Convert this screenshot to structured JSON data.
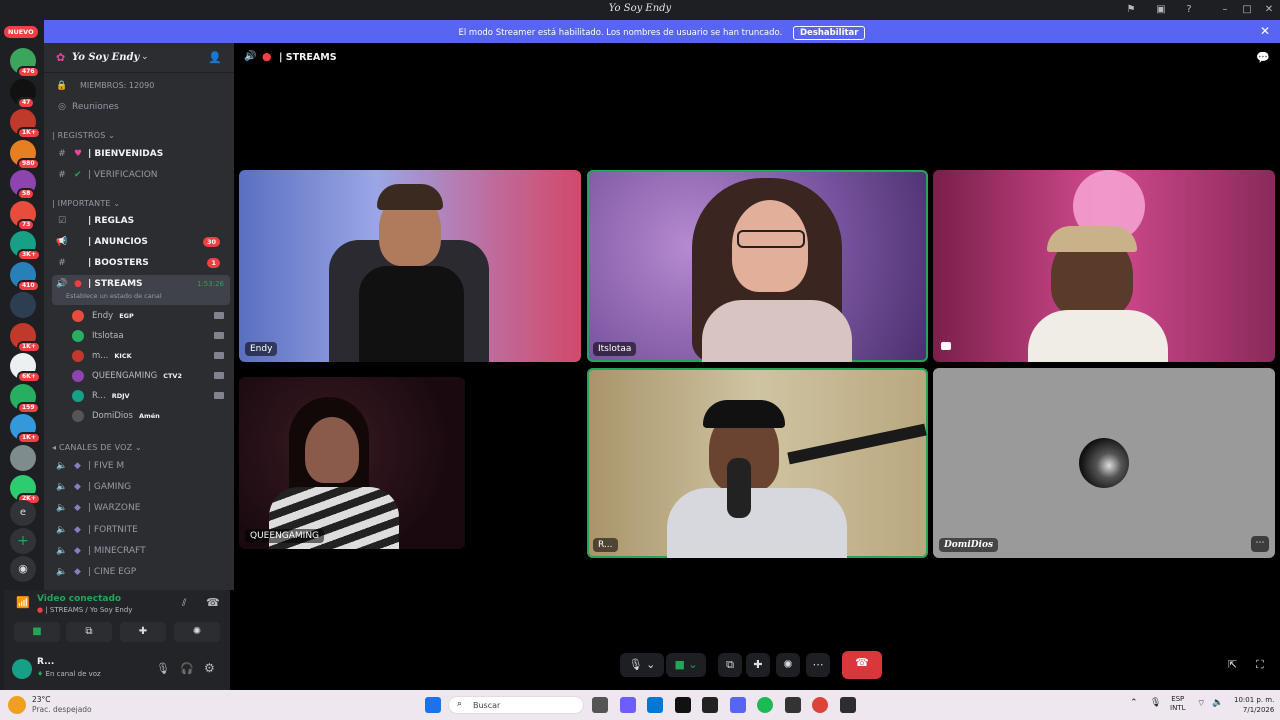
{
  "window": {
    "title": "Yo Soy Endy"
  },
  "banner": {
    "message": "El modo Streamer está habilitado. Los nombres de usuario se han truncado.",
    "button": "Deshabilitar"
  },
  "rail": {
    "new_label": "NUEVO",
    "servers": [
      {
        "badge": "476",
        "color": "#3ba55d"
      },
      {
        "badge": "47",
        "color": "#111111"
      },
      {
        "badge": "1K+",
        "color": "#c0392b"
      },
      {
        "badge": "980",
        "color": "#e67e22"
      },
      {
        "badge": "58",
        "color": "#8e44ad"
      },
      {
        "badge": "73",
        "color": "#e74c3c"
      },
      {
        "badge": "3K+",
        "color": "#16a085"
      },
      {
        "badge": "410",
        "color": "#2980b9"
      },
      {
        "badge": "",
        "color": "#2c3e50"
      },
      {
        "badge": "1K+",
        "color": "#c0392b"
      },
      {
        "badge": "6K+",
        "color": "#ecf0f1"
      },
      {
        "badge": "159",
        "color": "#27ae60"
      },
      {
        "badge": "1K+",
        "color": "#3498db"
      },
      {
        "badge": "",
        "color": "#7f8c8d"
      },
      {
        "badge": "2K+",
        "color": "#2ecc71"
      }
    ]
  },
  "server": {
    "name": "Yo Soy Endy"
  },
  "channels": {
    "members": "MIEMBROS: 12090",
    "meetings": "Reuniones",
    "cat_registros": "| REGISTROS",
    "bienvenidas": "| BIENVENIDAS",
    "verificacion": "| VERIFICACION",
    "cat_importante": "| IMPORTANTE",
    "reglas": "| REGLAS",
    "anuncios": "| ANUNCIOS",
    "anuncios_badge": "30",
    "boosters": "| BOOSTERS",
    "boosters_badge": "1",
    "streams": "| STREAMS",
    "streams_time": "1:53:26",
    "streams_status": "Establece un estado de canal",
    "voice_users": [
      {
        "name": "Endy",
        "tag": "EGP",
        "color": "#e74c3c"
      },
      {
        "name": "Itslotaa",
        "tag": "",
        "color": "#27ae60"
      },
      {
        "name": "m...",
        "tag": "KICK",
        "color": "#c0392b"
      },
      {
        "name": "QUEENGAMING",
        "tag": "CTV2",
        "color": "#8e44ad"
      },
      {
        "name": "R...",
        "tag": "RDJV",
        "color": "#16a085"
      },
      {
        "name": "DomiDios",
        "tag": "Amén",
        "color": "#555555"
      }
    ],
    "cat_voz": "CANALES DE VOZ",
    "voice_channels": [
      "| FIVE M",
      "| GAMING",
      "| WARZONE",
      "| FORTNITE",
      "| MINECRAFT",
      "| CINE EGP"
    ]
  },
  "voice_panel": {
    "status": "Video conectado",
    "location": "| STREAMS / Yo Soy Endy"
  },
  "user_panel": {
    "name": "R...",
    "status": "En canal de voz"
  },
  "main": {
    "channel_title": "| STREAMS",
    "tiles": [
      {
        "label": "Endy"
      },
      {
        "label": "Itslotaa"
      },
      {
        "label": ""
      },
      {
        "label": "QUEENGAMING"
      },
      {
        "label": "R..."
      },
      {
        "label": "DomiDios"
      }
    ]
  },
  "taskbar": {
    "weather_temp": "23°C",
    "weather_desc": "Prac. despejado",
    "search": "Buscar",
    "lang1": "ESP",
    "lang2": "INTL",
    "time": "10:01 p. m.",
    "date": "7/1/2026"
  },
  "colors": {
    "blurple": "#5865f2",
    "green": "#23a55a",
    "red": "#da373c"
  }
}
